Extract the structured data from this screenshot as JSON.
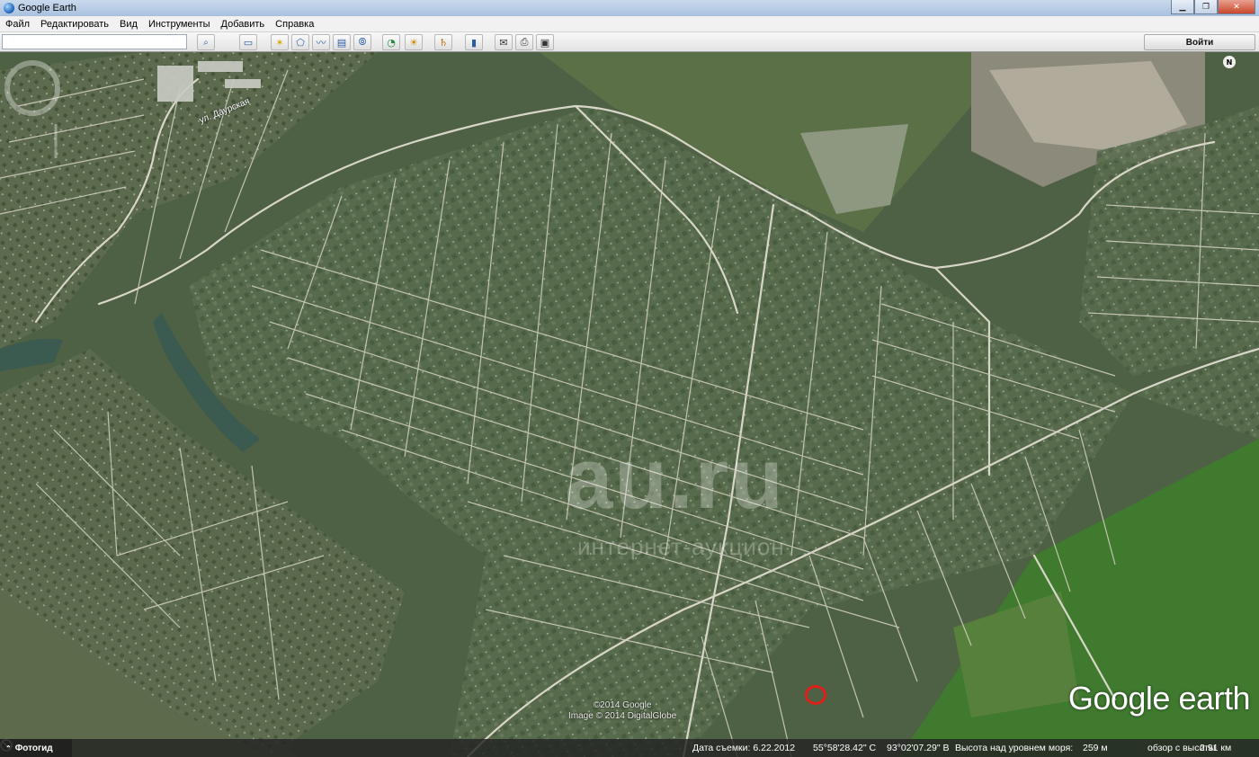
{
  "window": {
    "title": "Google Earth"
  },
  "menu": [
    "Файл",
    "Редактировать",
    "Вид",
    "Инструменты",
    "Добавить",
    "Справка"
  ],
  "toolbar": {
    "search_value": "",
    "signin_label": "Войти",
    "buttons": [
      {
        "name": "search-icon",
        "glyph": "🔍"
      },
      {
        "name": "sidebar-icon",
        "glyph": "▭"
      },
      {
        "name": "placemark-icon",
        "glyph": "✶"
      },
      {
        "name": "polygon-icon",
        "glyph": "⬠"
      },
      {
        "name": "path-icon",
        "glyph": "〰"
      },
      {
        "name": "overlay-icon",
        "glyph": "▤"
      },
      {
        "name": "record-tour-icon",
        "glyph": "⦾"
      },
      {
        "name": "historical-imagery-icon",
        "glyph": "◔"
      },
      {
        "name": "sunlight-icon",
        "glyph": "☀"
      },
      {
        "name": "planets-icon",
        "glyph": "♄"
      },
      {
        "name": "ruler-icon",
        "glyph": "▮"
      },
      {
        "name": "email-icon",
        "glyph": "✉"
      },
      {
        "name": "print-icon",
        "glyph": "⎙"
      },
      {
        "name": "view-in-maps-icon",
        "glyph": "▣"
      }
    ]
  },
  "map": {
    "road_label": "ул. Даурская",
    "watermark_main": "au.ru",
    "watermark_sub": "интернет-аукцион",
    "copyright_line1": "©2014 Google",
    "copyright_line2": "Image © 2014 DigitalGlobe",
    "logo_google": "Google",
    "logo_earth": "earth",
    "north": "N"
  },
  "statusbar": {
    "photo_tab": "Фотогид",
    "date": "Дата съемки: 6.22.2012",
    "lat": "55°58'28.42\" С",
    "lon": "93°02'07.29\" В",
    "elevation_label": "Высота над уровнем моря:",
    "elevation_value": "259 м",
    "eye_label": "обзор с высоты",
    "eye_value": "2.91 км"
  }
}
